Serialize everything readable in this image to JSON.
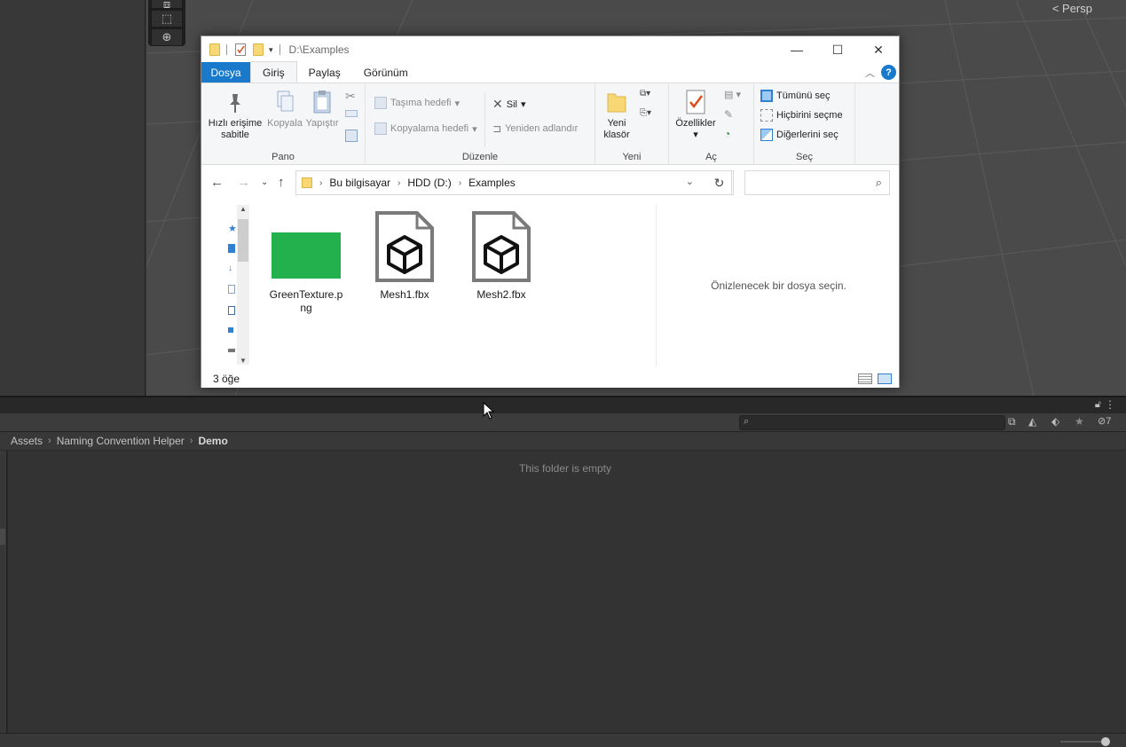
{
  "scene": {
    "persp_label": "Persp"
  },
  "explorer": {
    "title_path": "D:\\Examples",
    "tabs": {
      "file": "Dosya",
      "home": "Giriş",
      "share": "Paylaş",
      "view": "Görünüm"
    },
    "help": "?",
    "ribbon": {
      "clipboard": {
        "label": "Pano",
        "pin_line1": "Hızlı erişime",
        "pin_line2": "sabitle",
        "copy": "Kopyala",
        "paste": "Yapıştır"
      },
      "organize": {
        "label": "Düzenle",
        "move_to": "Taşıma hedefi",
        "copy_to": "Kopyalama hedefi",
        "delete": "Sil",
        "rename": "Yeniden adlandır"
      },
      "new": {
        "label": "Yeni",
        "new_folder_line1": "Yeni",
        "new_folder_line2": "klasör"
      },
      "open": {
        "label": "Aç",
        "properties": "Özellikler"
      },
      "select": {
        "label": "Seç",
        "select_all": "Tümünü seç",
        "select_none": "Hiçbirini seçme",
        "invert": "Diğerlerini seç"
      }
    },
    "address": {
      "crumbs": [
        "Bu bilgisayar",
        "HDD (D:)",
        "Examples"
      ]
    },
    "files": [
      {
        "name_line1": "GreenTexture.p",
        "name_line2": "ng",
        "type": "image",
        "color": "#22b14c"
      },
      {
        "name_line1": "Mesh1.fbx",
        "name_line2": "",
        "type": "fbx"
      },
      {
        "name_line1": "Mesh2.fbx",
        "name_line2": "",
        "type": "fbx"
      }
    ],
    "preview_text": "Önizlenecek bir dosya seçin.",
    "status": "3 öğe"
  },
  "project": {
    "hidden_count": "7",
    "breadcrumb": [
      "Assets",
      "Naming Convention Helper"
    ],
    "breadcrumb_current": "Demo",
    "empty_message": "This folder is empty"
  },
  "colors": {
    "unity_bg": "#383838",
    "explorer_accent": "#1979ca",
    "texture_green": "#22b14c"
  }
}
